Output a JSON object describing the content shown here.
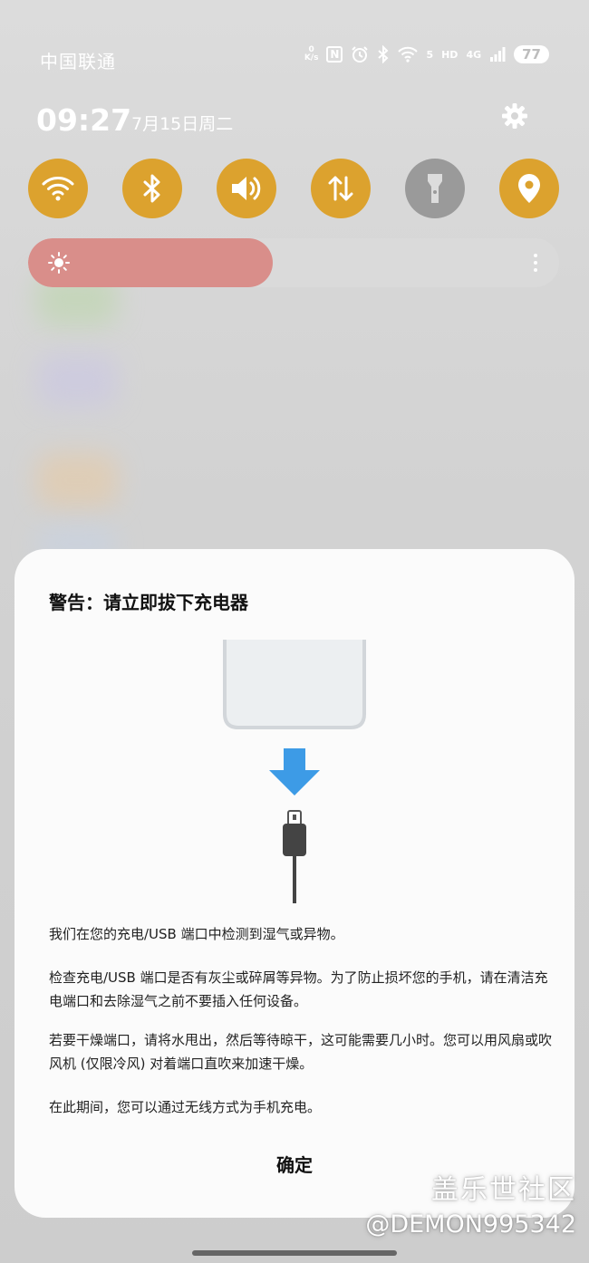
{
  "status_bar": {
    "carrier": "中国联通",
    "speed_value": "0",
    "speed_unit": "K/s",
    "nfc": "N",
    "wifi_label": "5",
    "hd_label": "HD",
    "cell_label": "4G",
    "battery": "77"
  },
  "header": {
    "time": "09:27",
    "date": "7月15日周二"
  },
  "quick_settings": [
    {
      "name": "wifi",
      "active": true
    },
    {
      "name": "bluetooth",
      "active": true
    },
    {
      "name": "sound",
      "active": true
    },
    {
      "name": "mobile-data",
      "active": true
    },
    {
      "name": "flashlight",
      "active": false
    },
    {
      "name": "location",
      "active": true
    }
  ],
  "brightness": {
    "level": 0.46
  },
  "dialog": {
    "title": "警告：请立即拔下充电器",
    "paragraphs": [
      "我们在您的充电/USB 端口中检测到湿气或异物。",
      "检查充电/USB 端口是否有灰尘或碎屑等异物。为了防止损坏您的手机，请在清洁充电端口和去除湿气之前不要插入任何设备。",
      "若要干燥端口，请将水甩出，然后等待晾干，这可能需要几小时。您可以用风扇或吹风机 (仅限冷风) 对着端口直吹来加速干燥。",
      "在此期间，您可以通过无线方式为手机充电。"
    ],
    "ok_label": "确定"
  },
  "watermark": {
    "line1": "盖乐世社区",
    "line2": "@DEMON995342"
  },
  "colors": {
    "accent": "#dca22e",
    "arrow": "#3d9be6",
    "brightness_fill": "#d98e8a"
  }
}
